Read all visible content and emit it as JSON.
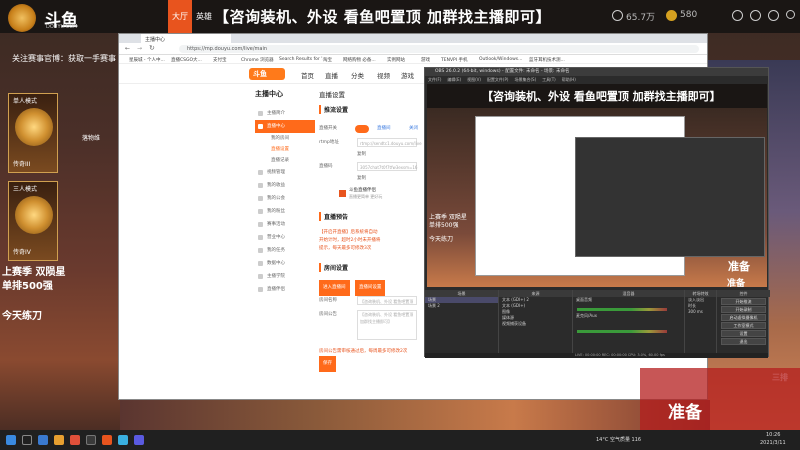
{
  "topbar": {
    "logo_text": "斗鱼",
    "logo_sub": "DOUYU.COM",
    "tab_hall": "大厅",
    "tab_rec": "英雄",
    "banner": "【咨询装机、外设 看鱼吧置顶 加群找主播即可】",
    "stat_views": "65.7万",
    "stat_coins": "580"
  },
  "left_panel": {
    "notice": "关注赛事官博：获取一手赛事",
    "mode1_label": "单人模式",
    "mode1_name": "传奇III",
    "mode2_label": "三人模式",
    "mode2_name": "传奇IV",
    "side_note": "落物维",
    "season": "上赛季 双陨星",
    "rank": "单排500强",
    "today": "今天练刀"
  },
  "browser": {
    "tab_label": "主播中心",
    "url": "https://mp.douyu.com/live/main",
    "bookmarks": [
      "星辰城 - 个人中...",
      "直播CSGO大...",
      "支付宝",
      "Chrome 浏览器",
      "Search Results for '...",
      "淘宝",
      "网络购物 必备...",
      "实例网站",
      "游戏",
      "TENVPI 手机",
      "Outlook/Windows...",
      "蓝牙耳机技术测..."
    ],
    "site_logo": "斗鱼",
    "nav": [
      "首页",
      "直播",
      "分类",
      "视频",
      "游戏"
    ],
    "menu_title": "主播中心",
    "menu": [
      {
        "label": "主播简介",
        "active": false
      },
      {
        "label": "直播中心",
        "active": true
      }
    ],
    "submenu": [
      {
        "label": "我的房间",
        "active": false
      },
      {
        "label": "直播设置",
        "active": true
      },
      {
        "label": "直播记录",
        "active": false
      }
    ],
    "menu2": [
      "视频管理",
      "我的收益",
      "我的公会",
      "我的粉丝",
      "赛事活动",
      "营业中心",
      "我的任务",
      "数据中心",
      "主播学院",
      "直播伴侣"
    ],
    "content_head": "直播设置",
    "sec1": "推流设置",
    "row_toggle": "直播开关",
    "toggle_link1": "直播间",
    "toggle_link2": "关闭",
    "row_rtmp": "rtmp地址",
    "rtmp_value": "rtmp://sendtc1.douyu.com/live",
    "copy1": "复制",
    "row_code": "直播码",
    "code_value": "3057chat7t0f7tfw3exsm=16",
    "copy2": "复制",
    "mobile_title": "斗鱼直播伴侣",
    "mobile_sub": "直播更简单 更好玩",
    "sec2": "直播预告",
    "notice_warn1": "【开启开直播】后系统将自动",
    "notice_warn2": "开始计时，超时2小时未开播将",
    "notice_warn3": "提示，每天最多可修改3次",
    "sec3": "房间设置",
    "room_btn1": "进入直播间",
    "room_btn2": "直播间设置",
    "row_name": "房间名称",
    "name_value": "【咨询装机、外设 看鱼吧置顶",
    "row_notice": "房间公告",
    "notice_value": "【咨询装机、外设 看鱼吧置顶 加群找主播即可】",
    "warn_last": "房间公告需审核通过后，每周最多可修改2次",
    "save_btn": "保存"
  },
  "obs": {
    "title": "OBS 26.0.2 (64-bit, windows) - 配置文件: 未命名 - 场景: 未命名",
    "menu": [
      "文件(F)",
      "编辑(E)",
      "视图(V)",
      "配置文件(P)",
      "场景集合(S)",
      "工具(T)",
      "帮助(H)"
    ],
    "preview_title": "【咨询装机、外设 看鱼吧置顶 加群找主播即可】",
    "preview_season": "上赛季 双陨星",
    "preview_rank": "单排500强",
    "preview_today": "今天练刀",
    "preview_ready": "准备",
    "dock_scenes": "场景",
    "scene_items": [
      "场景",
      "场景 2"
    ],
    "dock_sources": "来源",
    "source_items": [
      "文本 (GDI+) 2",
      "文本 (GDI+)",
      "图像",
      "媒体源",
      "视频捕获设备"
    ],
    "dock_mixer": "混音器",
    "mixer_items": [
      "桌面音频",
      "麦克风/Aux"
    ],
    "dock_transitions": "转场特效",
    "transition_value": "淡入淡出",
    "duration_label": "时长",
    "duration_value": "300 ms",
    "dock_controls": "控件",
    "controls": [
      "开始推流",
      "开始录制",
      "启动虚拟摄像机",
      "工作室模式",
      "设置",
      "退出"
    ],
    "status": "LIVE: 00:00:00  REC: 00:00:00  CPU: 3.0%, 60.00 fps"
  },
  "overlay": {
    "ready_big": "准备",
    "ready_small": "准备",
    "three": "三排"
  },
  "taskbar": {
    "weather": "14°C 空气质量 116",
    "time": "10:26",
    "date": "2021/3/11"
  }
}
